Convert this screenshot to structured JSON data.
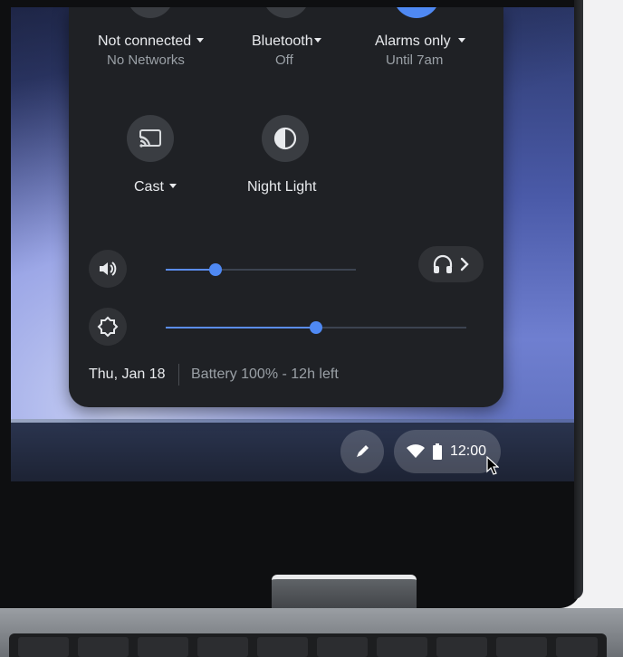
{
  "quick_settings": {
    "network": {
      "label": "Not connected",
      "sub": "No Networks"
    },
    "bluetooth": {
      "label": "Bluetooth",
      "sub": "Off"
    },
    "alarms": {
      "label": "Alarms only",
      "sub": "Until 7am"
    },
    "cast": {
      "label": "Cast"
    },
    "night_light": {
      "label": "Night Light"
    },
    "volume": {
      "level": 0.26
    },
    "brightness": {
      "level": 0.5
    },
    "footer": {
      "date": "Thu, Jan 18",
      "battery": "Battery 100% - 12h left"
    }
  },
  "shelf": {
    "time": "12:00"
  },
  "colors": {
    "panel": "#1f2125",
    "accent": "#4f89f3",
    "shelf_bg": "#1d2334"
  },
  "icons": [
    "cast-icon",
    "night-light-icon",
    "volume-icon",
    "brightness-icon",
    "headphones-icon",
    "chevron-right-icon",
    "stylus-icon",
    "wifi-icon",
    "battery-icon",
    "mouse-cursor-icon"
  ]
}
